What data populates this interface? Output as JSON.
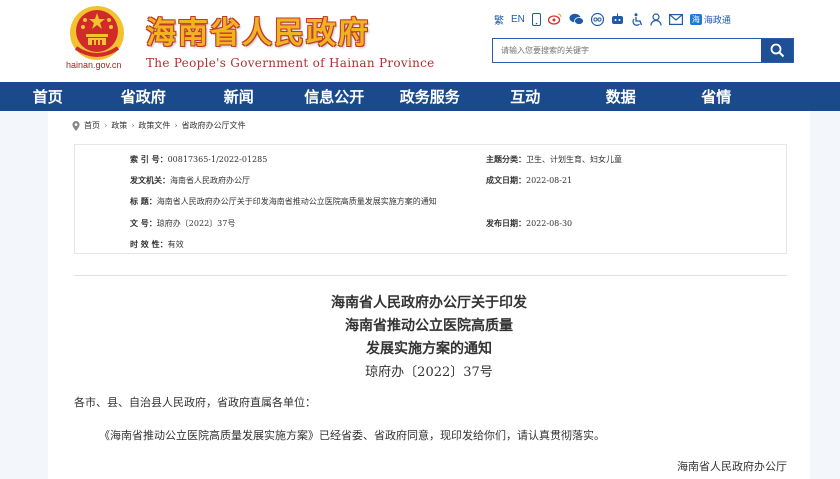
{
  "header": {
    "emblem_label": "national-emblem",
    "domain": "hainan.gov.cn",
    "title": "海南省人民政府",
    "subtitle": "The People's Government  of Hainan Province",
    "toolbar": {
      "traditional": "繁",
      "english": "EN",
      "app_badge": "海政通"
    },
    "search": {
      "placeholder": "请输入您要搜索的关键字"
    }
  },
  "nav": {
    "items": [
      {
        "label": "首页"
      },
      {
        "label": "省政府"
      },
      {
        "label": "新闻"
      },
      {
        "label": "信息公开"
      },
      {
        "label": "政务服务"
      },
      {
        "label": "互动"
      },
      {
        "label": "数据"
      },
      {
        "label": "省情"
      }
    ]
  },
  "breadcrumb": [
    "首页",
    "政策",
    "政策文件",
    "省政府办公厅文件"
  ],
  "meta": {
    "index_label": "索  引  号：",
    "index_value": "00817365-1/2022-01285",
    "category_label": "主题分类：",
    "category_value": "卫生、计划生育、妇女儿童",
    "issuer_label": "发文机关：",
    "issuer_value": "海南省人民政府办公厅",
    "written_label": "成文日期：",
    "written_value": "2022-08-21",
    "title_label": "标    题：",
    "title_value": "海南省人民政府办公厅关于印发海南省推动公立医院高质量发展实施方案的通知",
    "docno_label": "文    号：",
    "docno_value": "琼府办〔2022〕37号",
    "publish_label": "发布日期：",
    "publish_value": "2022-08-30",
    "validity_label": "时  效  性：",
    "validity_value": "有效"
  },
  "document": {
    "title_line1": "海南省人民政府办公厅关于印发",
    "title_line2": "海南省推动公立医院高质量",
    "title_line3": "发展实施方案的通知",
    "doc_number": "琼府办〔2022〕37号",
    "salutation": "各市、县、自治县人民政府，省政府直属各单位：",
    "body": "《海南省推动公立医院高质量发展实施方案》已经省委、省政府同意，现印发给你们，请认真贯彻落实。",
    "signature": "海南省人民政府办公厅"
  },
  "colors": {
    "nav_bg": "#1b4a8c",
    "title_gold": "#f0b420",
    "title_outline": "#c0392b",
    "search_border": "#2a5caa"
  }
}
